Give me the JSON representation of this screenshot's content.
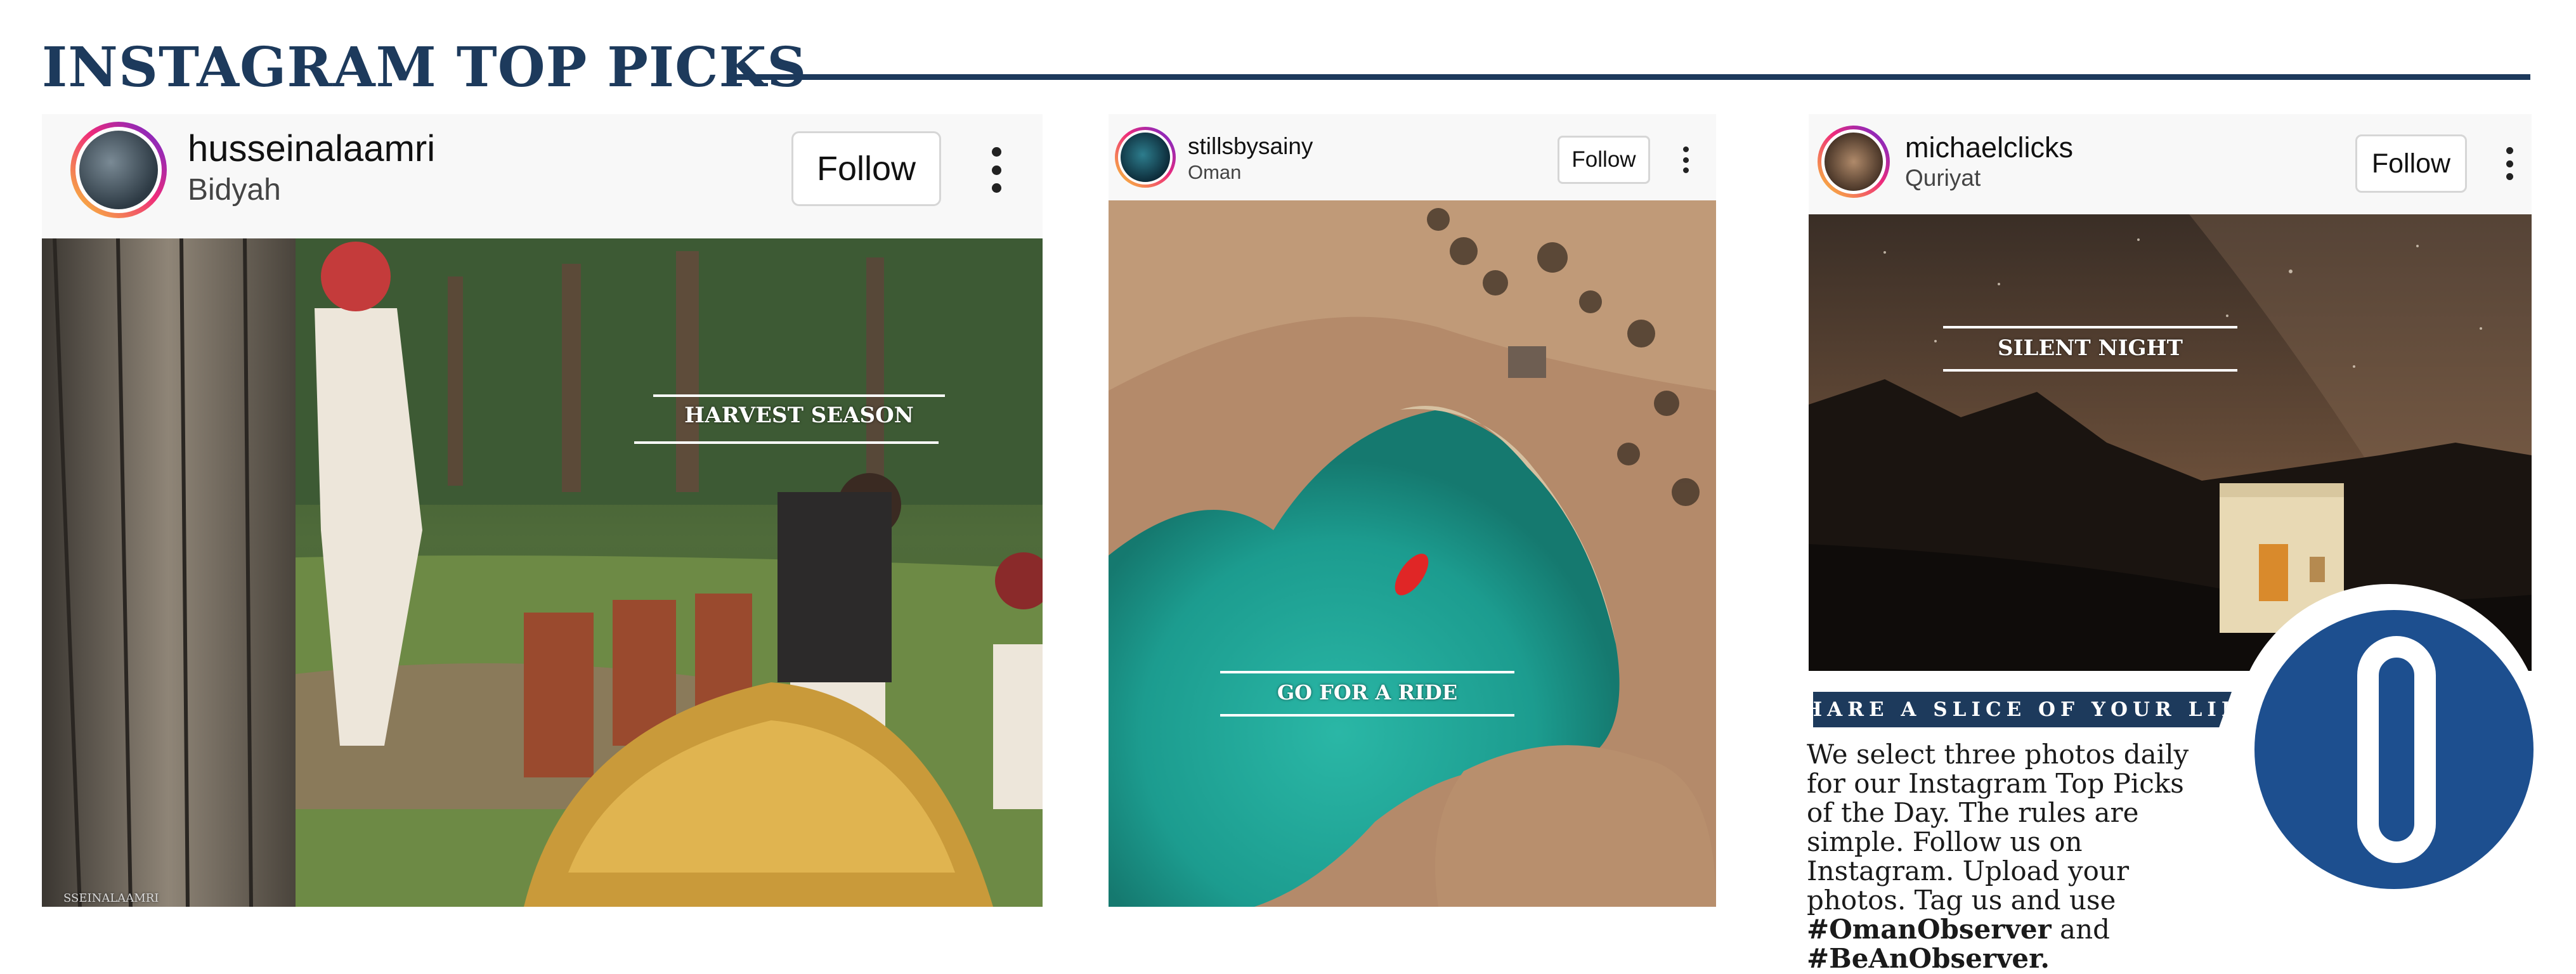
{
  "page": {
    "title": "INSTAGRAM TOP PICKS",
    "colors": {
      "navy": "#1d3a5c",
      "logo_blue": "#1d4f8f",
      "caption_text": "#ffffff"
    }
  },
  "posts": [
    {
      "username": "husseinalaamri",
      "location": "Bidyah",
      "follow_label": "Follow",
      "caption": "HARVEST SEASON",
      "photo_icon": "date-harvest-photo",
      "watermark": "SSEINALAAMRI"
    },
    {
      "username": "stillsbysainy",
      "location": "Oman",
      "follow_label": "Follow",
      "caption": "GO FOR A RIDE",
      "photo_icon": "aerial-lagoon-photo"
    },
    {
      "username": "michaelclicks",
      "location": "Quriyat",
      "follow_label": "Follow",
      "caption": "SILENT NIGHT",
      "photo_icon": "night-fort-photo"
    }
  ],
  "share": {
    "banner": "SHARE A SLICE OF YOUR LIFE",
    "body": "We select three photos daily for our Instagram Top Picks of the Day. The rules are simple. Follow us on Instagram. Upload your photos. Tag us and use",
    "tag1": "#OmanObserver",
    "joiner": "and",
    "tag2": "#BeAnObserver.",
    "logo_icon": "oman-observer-logo-icon",
    "logo_letter": "O"
  }
}
